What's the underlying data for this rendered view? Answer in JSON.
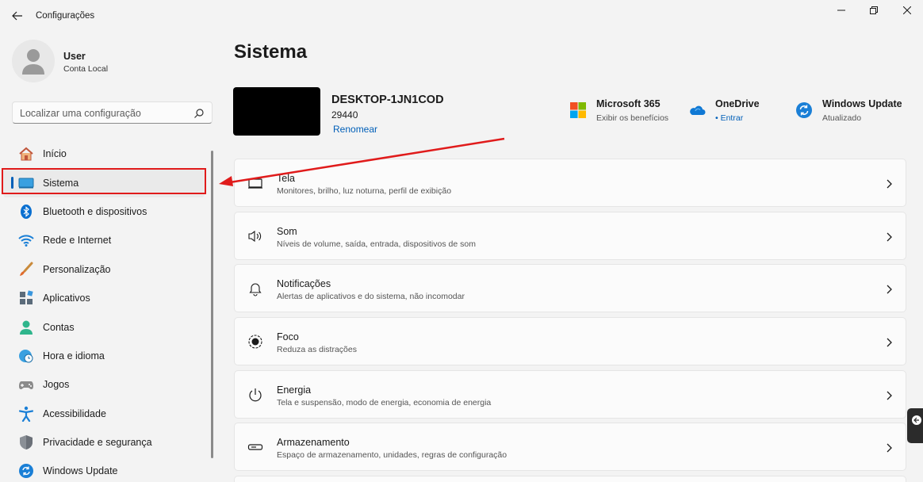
{
  "window": {
    "title": "Configurações"
  },
  "profile": {
    "name": "User",
    "account_type": "Conta Local"
  },
  "search": {
    "placeholder": "Localizar uma configuração"
  },
  "sidebar": {
    "items": [
      {
        "label": "Início",
        "icon": "home-icon"
      },
      {
        "label": "Sistema",
        "icon": "monitor-icon",
        "active": true
      },
      {
        "label": "Bluetooth e dispositivos",
        "icon": "bluetooth-icon"
      },
      {
        "label": "Rede e Internet",
        "icon": "wifi-icon"
      },
      {
        "label": "Personalização",
        "icon": "brush-icon"
      },
      {
        "label": "Aplicativos",
        "icon": "apps-icon"
      },
      {
        "label": "Contas",
        "icon": "person-icon"
      },
      {
        "label": "Hora e idioma",
        "icon": "globe-clock-icon"
      },
      {
        "label": "Jogos",
        "icon": "gamepad-icon"
      },
      {
        "label": "Acessibilidade",
        "icon": "accessibility-icon"
      },
      {
        "label": "Privacidade e segurança",
        "icon": "shield-icon"
      },
      {
        "label": "Windows Update",
        "icon": "update-icon"
      }
    ]
  },
  "main": {
    "title": "Sistema",
    "device": {
      "name": "DESKTOP-1JN1COD",
      "number": "29440",
      "rename_label": "Renomear"
    },
    "quick_links": [
      {
        "title": "Microsoft 365",
        "subtitle": "Exibir os benefícios",
        "icon": "microsoft-logo-icon"
      },
      {
        "title": "OneDrive",
        "subtitle": "• Entrar",
        "icon": "cloud-icon"
      },
      {
        "title": "Windows Update",
        "subtitle": "Atualizado",
        "icon": "update-icon"
      }
    ],
    "cards": [
      {
        "title": "Tela",
        "subtitle": "Monitores, brilho, luz noturna, perfil de exibição",
        "icon": "display-icon"
      },
      {
        "title": "Som",
        "subtitle": "Níveis de volume, saída, entrada, dispositivos de som",
        "icon": "speaker-icon"
      },
      {
        "title": "Notificações",
        "subtitle": "Alertas de aplicativos e do sistema, não incomodar",
        "icon": "bell-icon"
      },
      {
        "title": "Foco",
        "subtitle": "Reduza as distrações",
        "icon": "focus-icon"
      },
      {
        "title": "Energia",
        "subtitle": "Tela e suspensão, modo de energia, economia de energia",
        "icon": "power-icon"
      },
      {
        "title": "Armazenamento",
        "subtitle": "Espaço de armazenamento, unidades, regras de configuração",
        "icon": "storage-icon"
      }
    ]
  },
  "colors": {
    "accent": "#005fb8",
    "annotation": "#e01b1b",
    "background": "#f3f3f3",
    "card": "#fbfbfb"
  }
}
